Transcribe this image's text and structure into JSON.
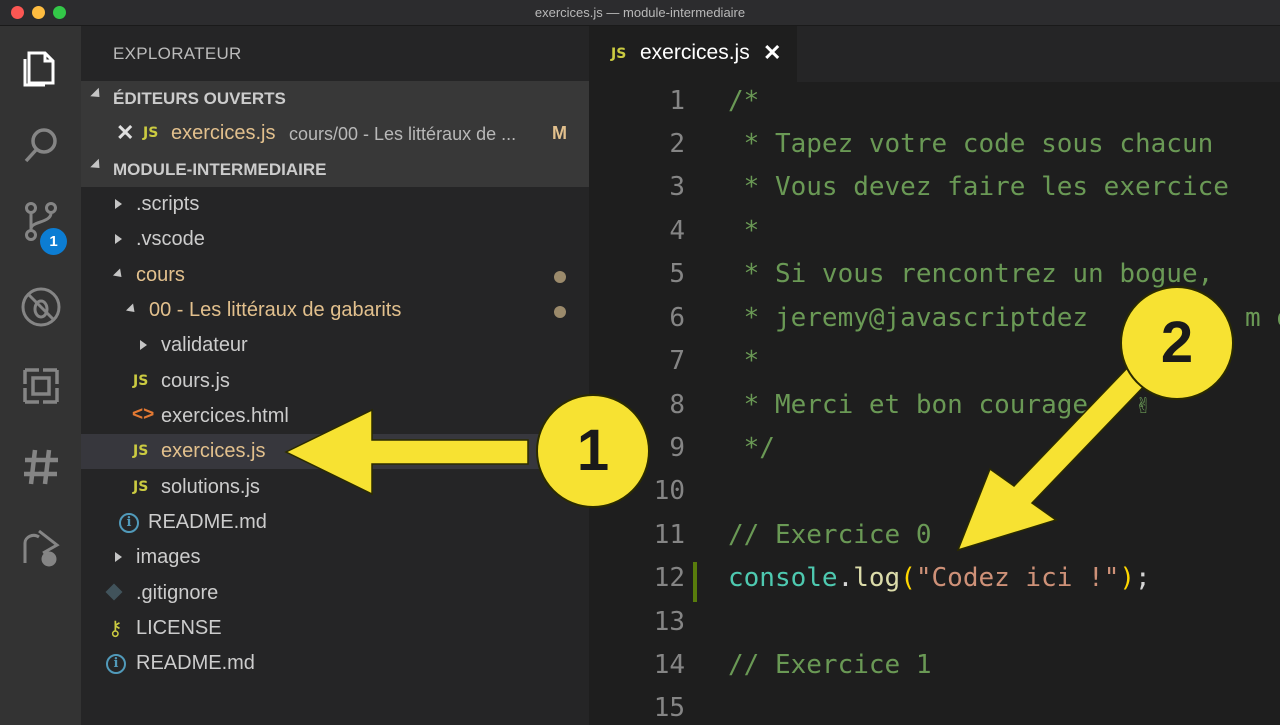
{
  "window": {
    "title": "exercices.js — module-intermediaire"
  },
  "activity": {
    "scm_badge": "1"
  },
  "sidebar": {
    "title": "EXPLORATEUR",
    "open_editors": {
      "header": "ÉDITEURS OUVERTS",
      "item": {
        "icon": "JS",
        "name": "exercices.js",
        "path": "cours/00 - Les littéraux de ...",
        "status": "M"
      }
    },
    "project": {
      "header": "MODULE-INTERMEDIAIRE",
      "items": [
        {
          "label": ".scripts"
        },
        {
          "label": ".vscode"
        },
        {
          "label": "cours"
        },
        {
          "label": "00 - Les littéraux de gabarits"
        },
        {
          "label": "validateur"
        },
        {
          "label": "cours.js",
          "icon": "JS"
        },
        {
          "label": "exercices.html",
          "icon": "<>"
        },
        {
          "label": "exercices.js",
          "icon": "JS"
        },
        {
          "label": "solutions.js",
          "icon": "JS"
        },
        {
          "label": "README.md",
          "icon": "i"
        },
        {
          "label": "images"
        },
        {
          "label": ".gitignore"
        },
        {
          "label": "LICENSE"
        },
        {
          "label": "README.md",
          "icon": "i"
        }
      ]
    }
  },
  "tab": {
    "icon": "JS",
    "name": "exercices.js",
    "close": "✕"
  },
  "editor": {
    "line_numbers": [
      "1",
      "2",
      "3",
      "4",
      "5",
      "6",
      "7",
      "8",
      "9",
      "10",
      "11",
      "12",
      "13",
      "14",
      "15"
    ],
    "lines": [
      "/*",
      " * Tapez votre code sous chacun",
      " * Vous devez faire les exercice",
      " *",
      " * Si vous rencontrez un bogue,",
      " * jeremy@javascriptdez",
      " *",
      " * Merci et bon courage ! ✌",
      " */",
      "",
      "// Exercice 0",
      "",
      "",
      "// Exercice 1",
      ""
    ],
    "line6_tail": "m o",
    "code12": {
      "obj": "console",
      "dot": ".",
      "fn": "log",
      "open": "(",
      "str": "\"Codez ici !\"",
      "close": ")",
      "semi": ";"
    }
  },
  "annotations": {
    "one": "1",
    "two": "2"
  }
}
